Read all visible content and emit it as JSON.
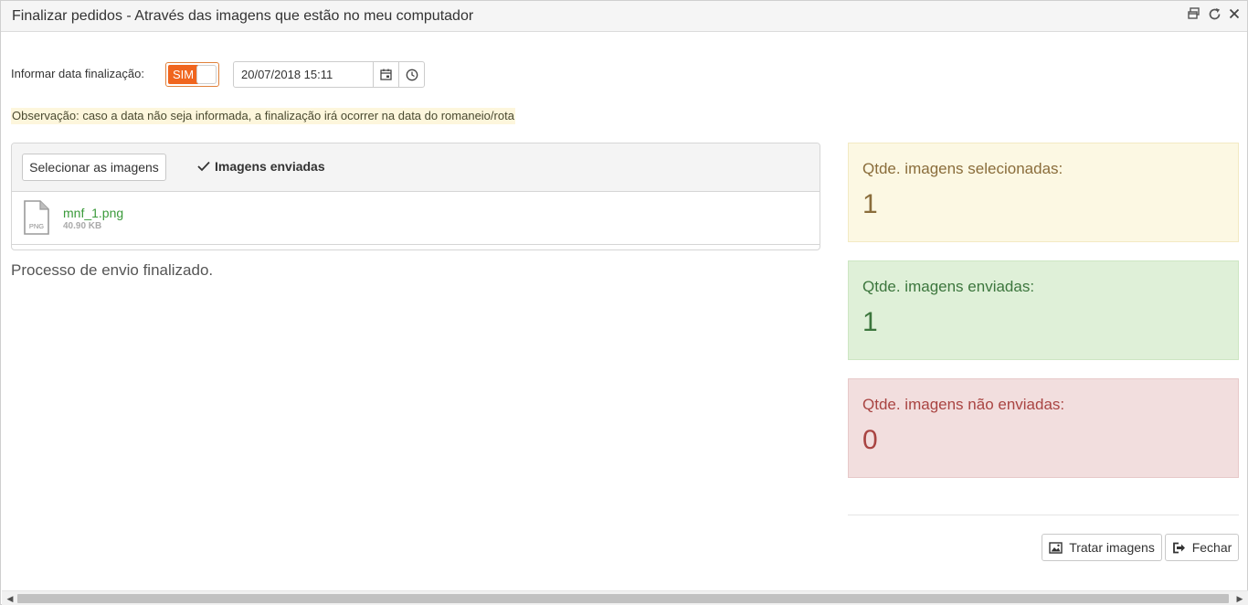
{
  "window": {
    "title": "Finalizar pedidos - Através das imagens que estão no meu computador",
    "icons": [
      "restore-icon",
      "refresh-icon",
      "close-icon"
    ]
  },
  "form": {
    "date_label": "Informar data finalização:",
    "toggle": {
      "label": "SIM",
      "checked": true,
      "color": "#f0651e"
    },
    "date_value": "20/07/2018 15:11",
    "date_icons": [
      "calendar-icon",
      "clock-icon"
    ],
    "observation": "Observação: caso a data não seja informada, a finalização irá ocorrer na data do romaneio/rota"
  },
  "upload": {
    "select_button": "Selecionar as imagens",
    "sent_label": "Imagens enviadas",
    "files": [
      {
        "name": "mnf_1.png",
        "size": "40.90 KB",
        "type": "PNG"
      }
    ],
    "status_message": "Processo de envio finalizado."
  },
  "stats": {
    "selected": {
      "label": "Qtde. imagens selecionadas:",
      "value": "1",
      "color": "#fcf8e3"
    },
    "sent": {
      "label": "Qtde. imagens enviadas:",
      "value": "1",
      "color": "#dff0d8"
    },
    "not_sent": {
      "label": "Qtde. imagens não enviadas:",
      "value": "0",
      "color": "#f2dede"
    }
  },
  "footer": {
    "tratar_label": "Tratar imagens",
    "fechar_label": "Fechar"
  }
}
